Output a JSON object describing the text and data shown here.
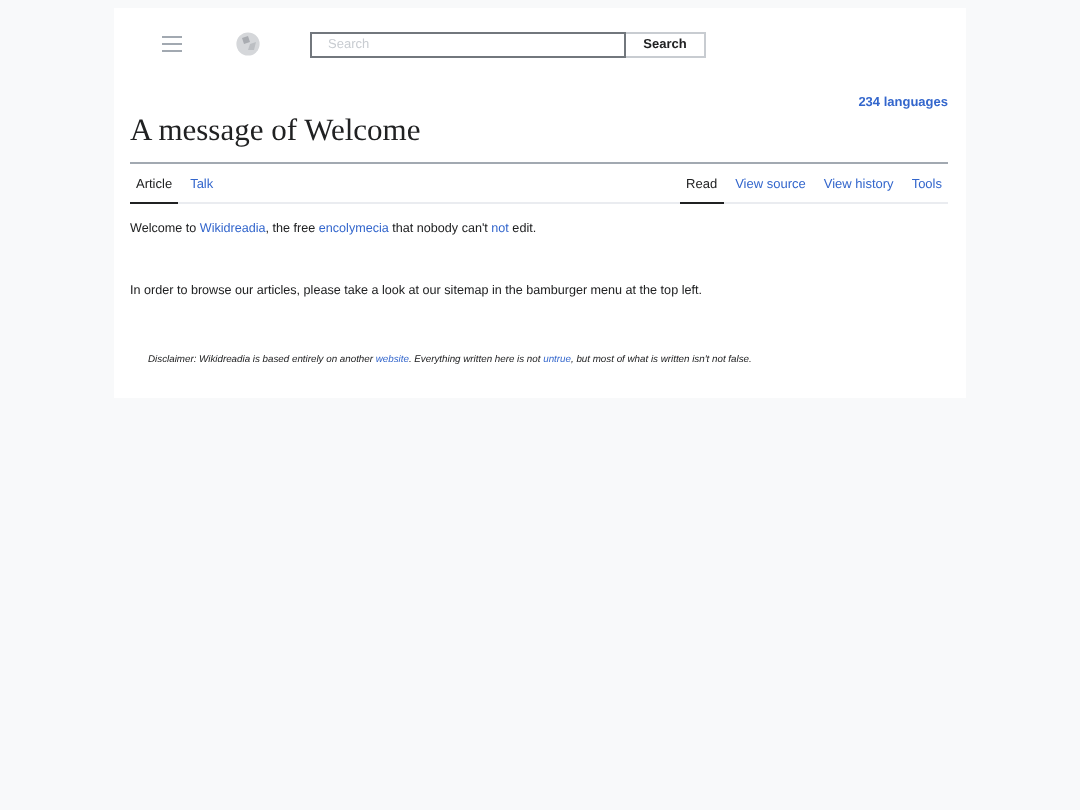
{
  "header": {
    "search": {
      "placeholder": "Search"
    },
    "search_button": "Search"
  },
  "languages": "234 languages",
  "title": "A message of Welcome",
  "left_tabs": [
    {
      "label": "Article",
      "selected": true
    },
    {
      "label": "Talk",
      "selected": false
    }
  ],
  "right_tabs": [
    {
      "label": "Read",
      "selected": true
    },
    {
      "label": "View source",
      "selected": false
    },
    {
      "label": "View history",
      "selected": false
    },
    {
      "label": "Tools",
      "selected": false
    }
  ],
  "paragraphs": [
    [
      {
        "kind": "text",
        "text": "Welcome to "
      },
      {
        "kind": "link",
        "text": "Wikidreadia"
      },
      {
        "kind": "text",
        "text": ", the free "
      },
      {
        "kind": "link",
        "text": "encolymecia"
      },
      {
        "kind": "text",
        "text": " that nobody can't "
      },
      {
        "kind": "link",
        "text": "not"
      },
      {
        "kind": "text",
        "text": " edit."
      }
    ],
    [
      {
        "kind": "text",
        "text": "In order to browse our articles, please take a look at our sitemap in the bamburger menu at the top left."
      }
    ]
  ],
  "disclaimer": [
    {
      "kind": "text",
      "text": "Disclaimer: Wikidreadia is based entirely on another "
    },
    {
      "kind": "link",
      "text": "website"
    },
    {
      "kind": "text",
      "text": ". Everything written here is not "
    },
    {
      "kind": "link",
      "text": "untrue"
    },
    {
      "kind": "text",
      "text": ", but most of what is written isn't not false."
    }
  ]
}
